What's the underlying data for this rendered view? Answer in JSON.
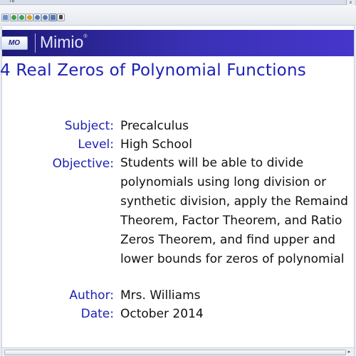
{
  "window": {
    "menu_label": "rb",
    "close_label": "x"
  },
  "toolbar": {
    "buttons": [
      {
        "name": "mail-icon",
        "color": "#6d8fc7"
      },
      {
        "name": "back-icon",
        "color": "#3fa34d"
      },
      {
        "name": "forward-icon",
        "color": "#3fa34d"
      },
      {
        "name": "refresh-icon",
        "color": "#d9a021"
      },
      {
        "name": "zoom-in-icon",
        "color": "#5577b0"
      },
      {
        "name": "zoom-out-icon",
        "color": "#5577b0"
      },
      {
        "name": "fit-page-icon",
        "color": "#5577b0"
      },
      {
        "name": "select-icon",
        "color": "#444444"
      }
    ]
  },
  "banner": {
    "logo_text": "MO",
    "brand_name": "Mimio",
    "brand_mark": "®"
  },
  "slide": {
    "title": "4 Real Zeros of Polynomial Functions",
    "subject_label": "Subject:",
    "subject_value": "Precalculus",
    "level_label": "Level:",
    "level_value": "High School",
    "objective_label": "Objective:",
    "objective_lines": [
      "Students will be able to divide",
      "polynomials using long division or",
      "synthetic division, apply the Remaind",
      "Theorem, Factor Theorem, and Ratio",
      "Zeros Theorem, and find upper and",
      "lower bounds for zeros of polynomial"
    ],
    "author_label": "Author:",
    "author_value": "Mrs. Williams",
    "date_label": "Date:",
    "date_value": "October 2014"
  },
  "colors": {
    "label_blue": "#1d22b6",
    "banner_dark": "#1d1a77",
    "banner_light": "#4636cb"
  }
}
